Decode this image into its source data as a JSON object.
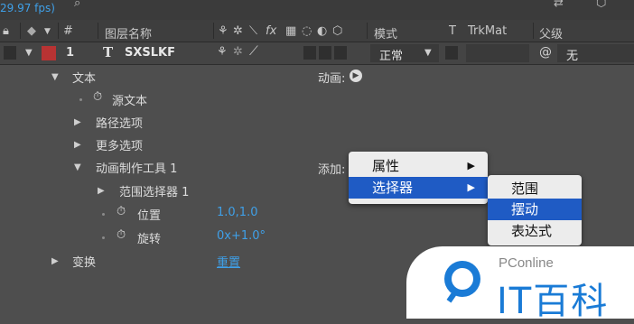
{
  "top": {
    "fps": "29.97 fps)"
  },
  "header": {
    "hash": "#",
    "layer_name": "图层名称",
    "mode": "模式",
    "t": "T",
    "trkmat": "TrkMat",
    "parent": "父级",
    "switch_fx": "fx"
  },
  "layer": {
    "index": "1",
    "type_glyph": "T",
    "name": "SXSLKF",
    "mode_value": "正常",
    "parent_value": "无",
    "label_color": "#b83333"
  },
  "rows": {
    "text": "文本",
    "animate_label": "动画:",
    "source_text": "源文本",
    "path_options": "路径选项",
    "more_options": "更多选项",
    "animator": "动画制作工具 1",
    "add_label": "添加:",
    "range_selector": "范围选择器 1",
    "position": "位置",
    "position_value": "1.0,1.0",
    "rotation": "旋转",
    "rotation_value": "0x+1.0°",
    "transform": "变换",
    "reset": "重置"
  },
  "menu": {
    "property": "属性",
    "selector": "选择器",
    "submenu": [
      "范围",
      "摆动",
      "表达式"
    ]
  },
  "watermark": {
    "brand": "PConline",
    "name": "IT百科"
  },
  "colors": {
    "accent": "#3fa0e8",
    "menu_selected": "#1f5bc4"
  }
}
